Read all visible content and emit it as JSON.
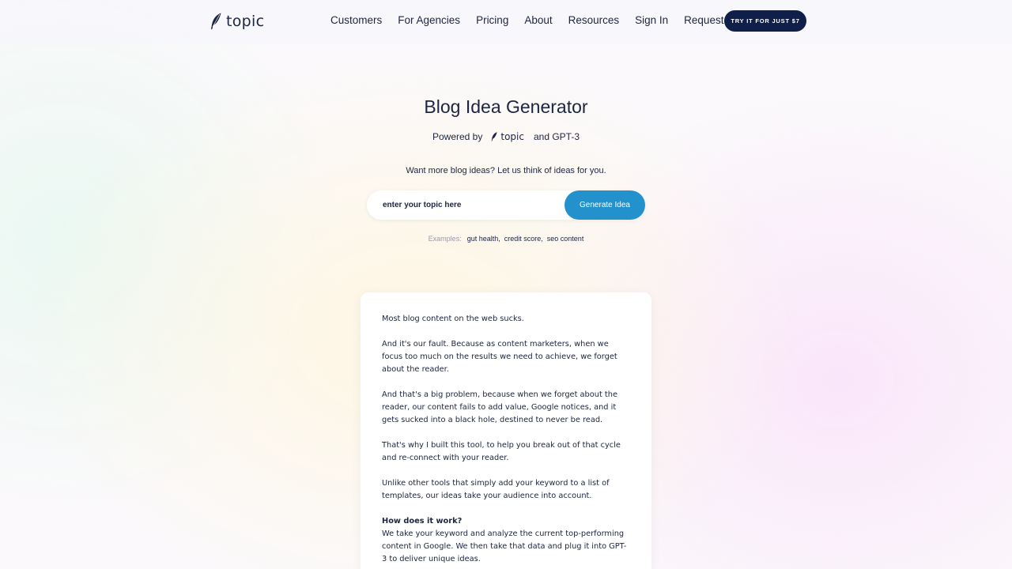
{
  "header": {
    "logo_text": "topic",
    "nav": [
      "Customers",
      "For Agencies",
      "Pricing",
      "About",
      "Resources",
      "Sign In",
      "Request Demo"
    ],
    "cta_label": "TRY IT FOR JUST $7"
  },
  "hero": {
    "title": "Blog Idea Generator",
    "powered_by": "Powered by",
    "powered_logo": "topic",
    "powered_suffix": "and GPT-3",
    "subtitle": "Want more blog ideas? Let us think of ideas for you."
  },
  "search": {
    "placeholder": "enter your topic here",
    "button_label": "Generate Idea"
  },
  "examples": {
    "label": "Examples:",
    "items": [
      "gut health,",
      "credit score,",
      "seo content"
    ]
  },
  "card": {
    "paragraphs": [
      "Most blog content on the web sucks.",
      "And it's our fault. Because as content marketers, when we focus too much on the results we need to achieve, we forget about the reader.",
      "And that's a big problem, because when we forget about the reader, our content fails to add value, Google notices, and it gets sucked into a black hole, destined to never be read.",
      "That's why I built this tool, to help you break out of that cycle and re-connect with your reader.",
      "Unlike other tools that simply add your keyword to a list of templates, our ideas take your audience into account."
    ],
    "how_heading": "How does it work?",
    "how_body": "We take your keyword and analyze the current top-performing content in Google. We then take that data and plug it into GPT-3 to deliver unique ideas."
  },
  "colors": {
    "navy": "#0f1f4a",
    "text": "#1c2541",
    "accent_blue": "#2291cc"
  },
  "icons": {
    "logo": "feather-icon"
  }
}
